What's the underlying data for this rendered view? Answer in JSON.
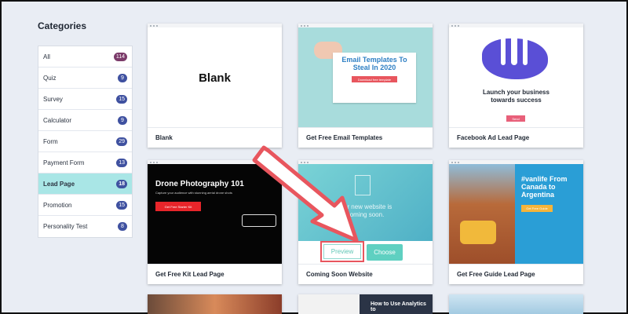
{
  "categories": {
    "title": "Categories",
    "items": [
      {
        "label": "All",
        "count": "114"
      },
      {
        "label": "Quiz",
        "count": "9"
      },
      {
        "label": "Survey",
        "count": "15"
      },
      {
        "label": "Calculator",
        "count": "9"
      },
      {
        "label": "Form",
        "count": "29"
      },
      {
        "label": "Payment Form",
        "count": "13"
      },
      {
        "label": "Lead Page",
        "count": "18"
      },
      {
        "label": "Promotion",
        "count": "15"
      },
      {
        "label": "Personality Test",
        "count": "8"
      }
    ],
    "active": "Lead Page"
  },
  "templates": [
    {
      "name": "Blank",
      "thumb_text": "Blank"
    },
    {
      "name": "Get Free Email Templates",
      "thumb_title": "Email Templates To Steal In 2020",
      "thumb_button": "Download free template"
    },
    {
      "name": "Facebook Ad Lead Page",
      "thumb_title": "Launch your business towards success",
      "thumb_button": "Send"
    },
    {
      "name": "Get Free Kit Lead Page",
      "thumb_title": "Drone Photography 101",
      "thumb_sub": "Capture your audience with stunning aerial drone shots",
      "thumb_button": "Get Free Starter Kit"
    },
    {
      "name": "Coming Soon Website",
      "thumb_title": "Our new website is coming soon.",
      "preview_label": "Preview",
      "choose_label": "Choose"
    },
    {
      "name": "Get Free Guide Lead Page",
      "thumb_title": "#vanlife From Canada to Argentina",
      "thumb_button": "Get Free Guide"
    }
  ],
  "partial": {
    "analytics_title": "How to Use Analytics to"
  },
  "colors": {
    "accent_teal": "#5fd0c1",
    "highlight_red": "#e8565e",
    "active_bg": "#a9e6e6"
  }
}
